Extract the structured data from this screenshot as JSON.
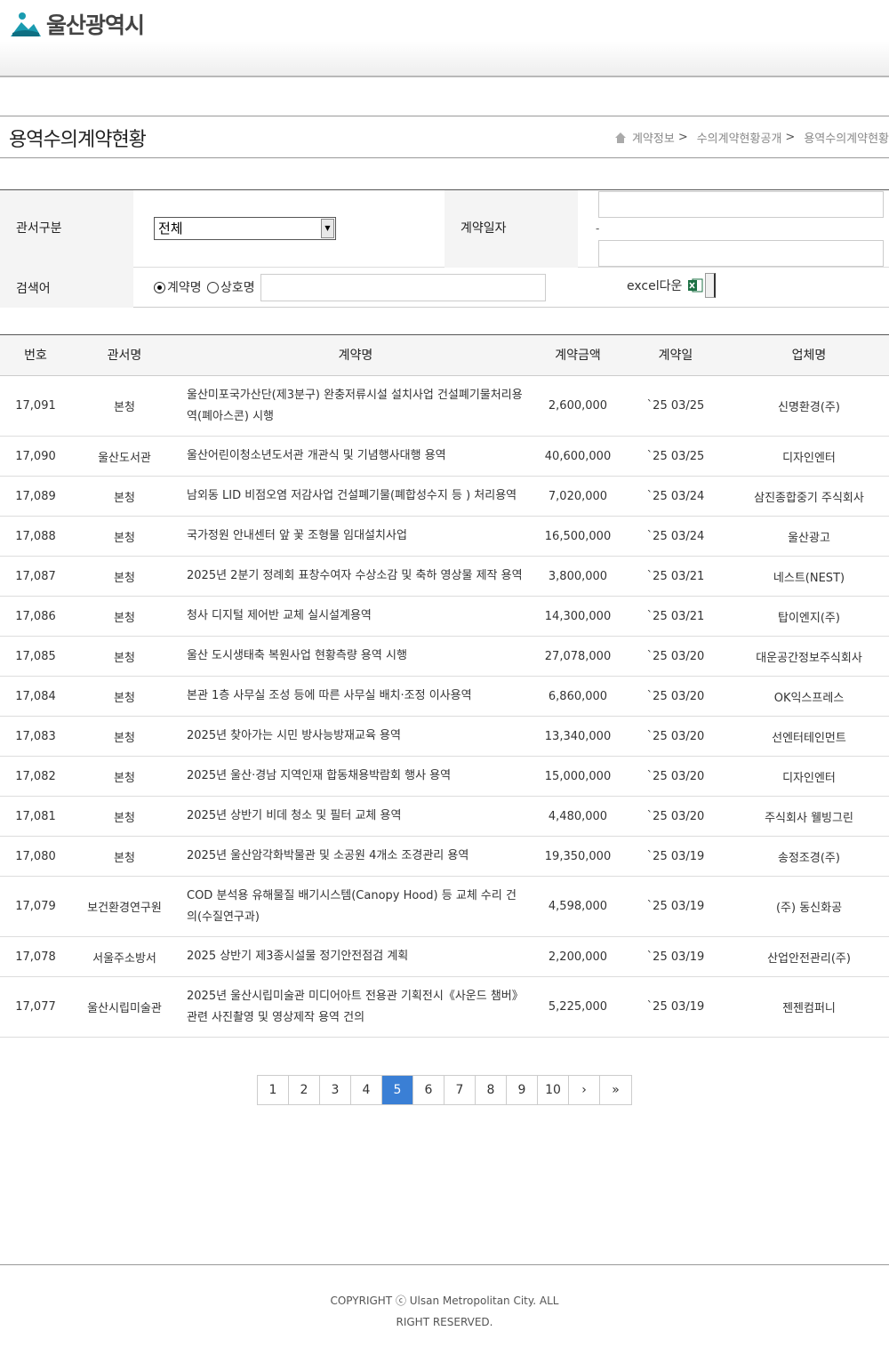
{
  "header": {
    "logo_text": "울산광역시"
  },
  "title": "용역수의계약현황",
  "breadcrumb": [
    "계약정보",
    "수의계약현황공개",
    "용역수의계약현황"
  ],
  "search": {
    "dept_label": "관서구분",
    "dept_value": "전체",
    "date_label": "계약일자",
    "date_sep": "-",
    "keyword_label": "검색어",
    "radio_contract": "계약명",
    "radio_company": "상호명",
    "excel_label": "excel다운"
  },
  "table": {
    "headers": [
      "번호",
      "관서명",
      "계약명",
      "계약금액",
      "계약일",
      "업체명"
    ],
    "rows": [
      {
        "no": "17,091",
        "dept": "본청",
        "name": "울산미포국가산단(제3분구) 완충저류시설 설치사업 건설폐기물처리용역(폐아스콘) 시행",
        "amount": "2,600,000",
        "date": "`25 03/25",
        "company": "신명환경(주)"
      },
      {
        "no": "17,090",
        "dept": "울산도서관",
        "name": "울산어린이청소년도서관 개관식 및 기념행사대행 용역",
        "amount": "40,600,000",
        "date": "`25 03/25",
        "company": "디자인엔터"
      },
      {
        "no": "17,089",
        "dept": "본청",
        "name": "남외동 LID 비점오염 저감사업 건설폐기물(폐합성수지 등 ) 처리용역",
        "amount": "7,020,000",
        "date": "`25 03/24",
        "company": "삼진종합중기 주식회사"
      },
      {
        "no": "17,088",
        "dept": "본청",
        "name": "국가정원 안내센터 앞 꽃 조형물 임대설치사업",
        "amount": "16,500,000",
        "date": "`25 03/24",
        "company": "울산광고"
      },
      {
        "no": "17,087",
        "dept": "본청",
        "name": "2025년 2분기 정례회 표창수여자 수상소감 및 축하 영상물 제작 용역",
        "amount": "3,800,000",
        "date": "`25 03/21",
        "company": "네스트(NEST)"
      },
      {
        "no": "17,086",
        "dept": "본청",
        "name": "청사 디지털 제어반 교체 실시설계용역",
        "amount": "14,300,000",
        "date": "`25 03/21",
        "company": "탑이엔지(주)"
      },
      {
        "no": "17,085",
        "dept": "본청",
        "name": "울산 도시생태축 복원사업 현황측량 용역 시행",
        "amount": "27,078,000",
        "date": "`25 03/20",
        "company": "대운공간정보주식회사"
      },
      {
        "no": "17,084",
        "dept": "본청",
        "name": "본관 1층 사무실 조성 등에 따른 사무실 배치·조정 이사용역",
        "amount": "6,860,000",
        "date": "`25 03/20",
        "company": "OK익스프레스"
      },
      {
        "no": "17,083",
        "dept": "본청",
        "name": "2025년 찾아가는 시민 방사능방재교육 용역",
        "amount": "13,340,000",
        "date": "`25 03/20",
        "company": "선엔터테인먼트"
      },
      {
        "no": "17,082",
        "dept": "본청",
        "name": "2025년 울산·경남 지역인재 합동채용박람회 행사 용역",
        "amount": "15,000,000",
        "date": "`25 03/20",
        "company": "디자인엔터"
      },
      {
        "no": "17,081",
        "dept": "본청",
        "name": "2025년 상반기 비데 청소 및 필터 교체 용역",
        "amount": "4,480,000",
        "date": "`25 03/20",
        "company": "주식회사 웰빙그린"
      },
      {
        "no": "17,080",
        "dept": "본청",
        "name": "2025년 울산암각화박물관 및 소공원 4개소 조경관리 용역",
        "amount": "19,350,000",
        "date": "`25 03/19",
        "company": "송정조경(주)"
      },
      {
        "no": "17,079",
        "dept": "보건환경연구원",
        "name": "COD 분석용 유해물질 배기시스템(Canopy Hood) 등 교체 수리 건의(수질연구과)",
        "amount": "4,598,000",
        "date": "`25 03/19",
        "company": "(주) 동신화공"
      },
      {
        "no": "17,078",
        "dept": "서울주소방서",
        "name": "2025 상반기 제3종시설물 정기안전점검 계획",
        "amount": "2,200,000",
        "date": "`25 03/19",
        "company": "산업안전관리(주)"
      },
      {
        "no": "17,077",
        "dept": "울산시립미술관",
        "name": "2025년 울산시립미술관 미디어아트 전용관 기획전시《사운드 챔버》관련 사진촬영 및 영상제작 용역 건의",
        "amount": "5,225,000",
        "date": "`25 03/19",
        "company": "젠젠컴퍼니"
      }
    ]
  },
  "pagination": {
    "pages": [
      "1",
      "2",
      "3",
      "4",
      "5",
      "6",
      "7",
      "8",
      "9",
      "10"
    ],
    "current": "5",
    "next": "›",
    "last": "»"
  },
  "footer": {
    "copyright": "COPYRIGHT ⓒ Ulsan Metropolitan City. ALL RIGHT RESERVED."
  },
  "colors": {
    "accent": "#3a7fd5",
    "logo_teal": "#1a9bb0",
    "excel_green": "#1e7145"
  }
}
